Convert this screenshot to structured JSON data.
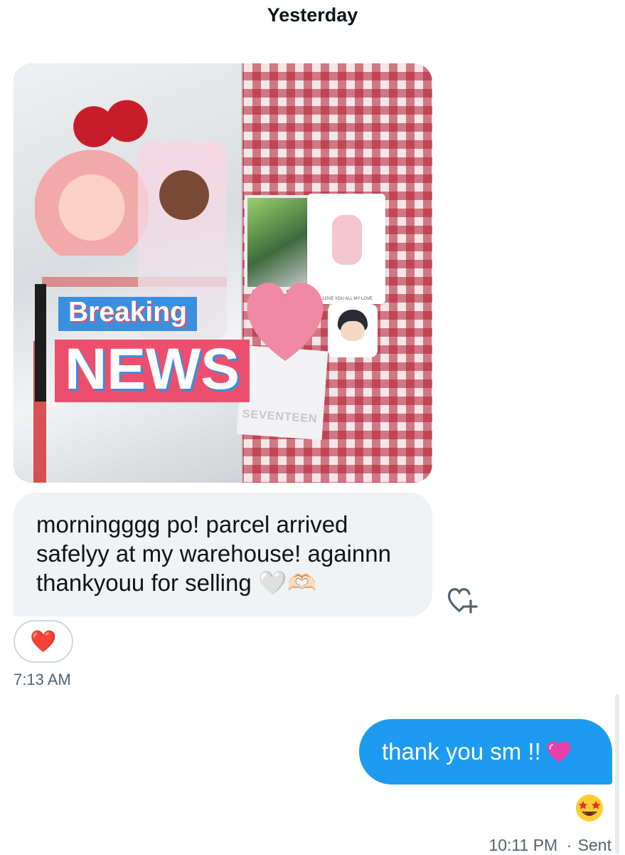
{
  "conversation": {
    "day_separator": "Yesterday"
  },
  "incoming": {
    "image": {
      "icon": "photo-thumbnail",
      "overlay_small": "Breaking",
      "overlay_large": "NEWS",
      "paper_text": "SEVENTEEN",
      "card_caption": "I LOVE YOU ALL MY LOVE"
    },
    "message_text": "morningggg po! parcel arrived safelyy at my warehouse! againnn thankyouu for selling 🤍🫶🏻",
    "reaction_emoji": "❤️",
    "add_reaction_icon": "heart-plus-icon",
    "timestamp": "7:13 AM"
  },
  "outgoing": {
    "message_text": "thank you sm !!",
    "message_emoji": "💗",
    "reaction_emoji": "🤩",
    "timestamp": "10:11 PM",
    "status": "Sent",
    "separator": "·"
  },
  "colors": {
    "outgoing_bubble": "#1d9bf0",
    "incoming_bubble": "#eff3f4",
    "meta_text": "#536471"
  }
}
